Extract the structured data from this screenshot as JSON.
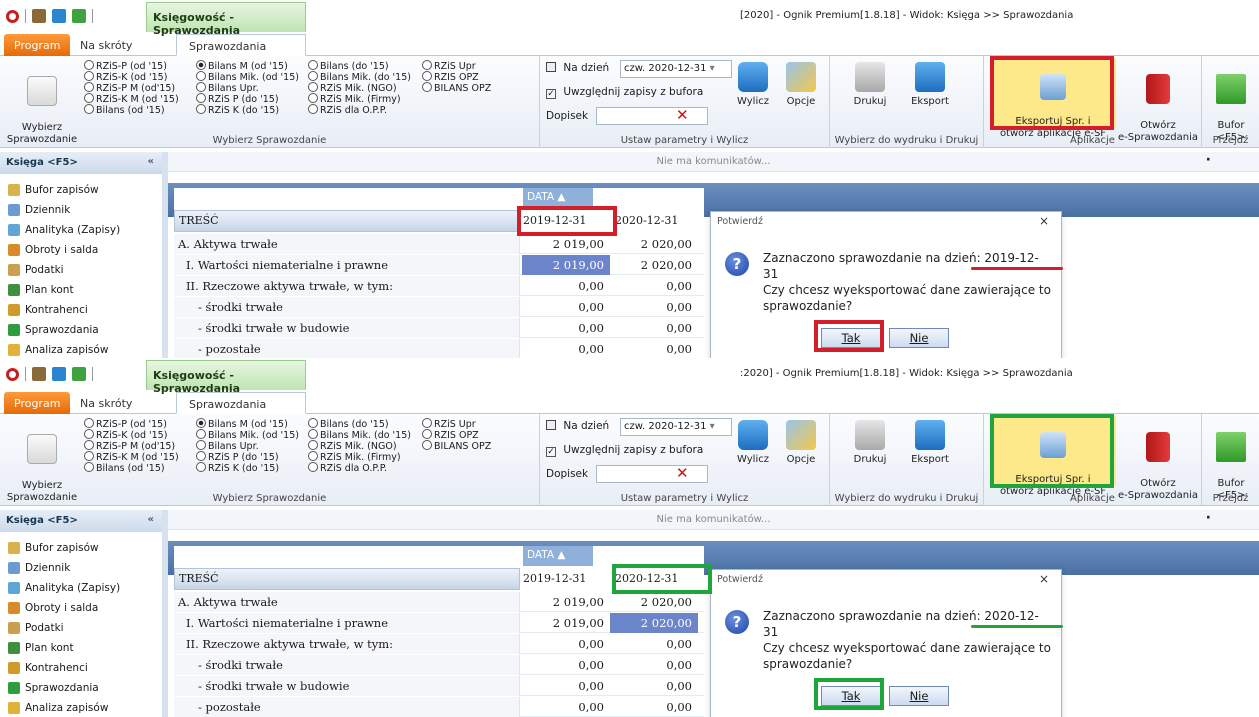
{
  "accent": {
    "red": "#d31f2a",
    "green": "#1ea53c",
    "orange": "#ea7a12"
  },
  "panels": [
    {
      "qat_icons": [
        "app-orb-icon",
        "calendar-icon",
        "document-blue-icon",
        "document-green-icon"
      ],
      "context_tab": "Księgowość - Sprawozdania",
      "window_title": "[2020] - Ognik Premium[1.8.18] - Widok: Księga >> Sprawozdania",
      "tabs": {
        "program": "Program",
        "shortcuts": "Na skróty",
        "reports": "Sprawozdania"
      },
      "ribbon": {
        "choose_report": {
          "label": "Wybierz\nSprawozdanie",
          "group": "Wybierz Sprawozdanie"
        },
        "radios_col1": [
          "RZiS-P (od '15)",
          "RZiS-K (od '15)",
          "RZiS-P M (od'15)",
          "RZiS-K M (od '15)",
          "Bilans (od '15)"
        ],
        "radios_col2": [
          "Bilans M (od '15)",
          "Bilans Mik. (od '15)",
          "Bilans Upr.",
          "RZiS P (do '15)",
          "RZiS K (do '15)"
        ],
        "radios_col3": [
          "Bilans (do '15)",
          "Bilans Mik. (do '15)",
          "RZiS Mik. (NGO)",
          "RZiS Mik. (Firmy)",
          "RZiS dla O.P.P."
        ],
        "radios_col4": [
          "RZiS Upr",
          "RZIS OPZ",
          "BILANS OPZ"
        ],
        "selected_radio": "Bilans M (od '15)",
        "params": {
          "date_label": "Na dzień",
          "date_value": "czw. 2020-12-31",
          "buffer_label": "Uwzględnij zapisy z bufora",
          "note_label": "Dopisek",
          "group": "Ustaw parametry i Wylicz"
        },
        "calc": "Wylicz",
        "options": "Opcje",
        "print": "Drukuj",
        "export": "Eksport",
        "print_group": "Wybierz do wydruku i Drukuj",
        "export_esf": "Eksportuj Spr. i\notwórz aplikację e-SF",
        "open_esf": "Otwórz\ne-Sprawozdania",
        "app_group": "Aplikacje",
        "buffer": "Bufor\n<F5>",
        "goto_group": "Przejdź"
      },
      "sidebar": {
        "title": "Księga <F5>",
        "items": [
          "Bufor zapisów",
          "Dziennik",
          "Analityka (Zapisy)",
          "Obroty i salda",
          "Podatki",
          "Plan kont",
          "Kontrahenci",
          "Sprawozdania",
          "Analiza zapisów"
        ]
      },
      "message": "Nie ma komunikatów...",
      "grid": {
        "group_header": "DATA ▲",
        "col_header": "TREŚĆ",
        "date_cols": [
          "2019-12-31",
          "2020-12-31"
        ],
        "rows": [
          {
            "label": "A. Aktywa trwałe",
            "v1": "2 019,00",
            "v2": "2 020,00"
          },
          {
            "label": "I. Wartości niematerialne i prawne",
            "v1": "2 019,00",
            "v2": "2 020,00"
          },
          {
            "label": "II. Rzeczowe aktywa trwałe, w tym:",
            "v1": "0,00",
            "v2": "0,00"
          },
          {
            "label": "- środki trwałe",
            "v1": "0,00",
            "v2": "0,00"
          },
          {
            "label": "- środki trwałe w budowie",
            "v1": "0,00",
            "v2": "0,00"
          },
          {
            "label": "- pozostałe",
            "v1": "0,00",
            "v2": "0,00"
          }
        ],
        "selected_col": 0
      },
      "dialog": {
        "title": "Potwierdź",
        "close": "×",
        "question_icon": "?",
        "line1": "Zaznaczono sprawozdanie na dzień: 2019-12-31",
        "line2": "Czy chcesz wyeksportować dane zawierające to sprawozdanie?",
        "yes": "Tak",
        "no": "Nie"
      },
      "highlight_color": "#d31f2a"
    },
    {
      "qat_icons": [
        "app-orb-icon",
        "calendar-icon",
        "document-blue-icon",
        "document-green-icon"
      ],
      "context_tab": "Księgowość - Sprawozdania",
      "window_title": ":2020] - Ognik Premium[1.8.18] - Widok: Księga >> Sprawozdania",
      "tabs": {
        "program": "Program",
        "shortcuts": "Na skróty",
        "reports": "Sprawozdania"
      },
      "ribbon": {
        "choose_report": {
          "label": "Wybierz\nSprawozdanie",
          "group": "Wybierz Sprawozdanie"
        },
        "radios_col1": [
          "RZiS-P (od '15)",
          "RZiS-K (od '15)",
          "RZiS-P M (od'15)",
          "RZiS-K M (od '15)",
          "Bilans (od '15)"
        ],
        "radios_col2": [
          "Bilans M (od '15)",
          "Bilans Mik. (od '15)",
          "Bilans Upr.",
          "RZiS P (do '15)",
          "RZiS K (do '15)"
        ],
        "radios_col3": [
          "Bilans (do '15)",
          "Bilans Mik. (do '15)",
          "RZiS Mik. (NGO)",
          "RZiS Mik. (Firmy)",
          "RZiS dla O.P.P."
        ],
        "radios_col4": [
          "RZiS Upr",
          "RZIS OPZ",
          "BILANS OPZ"
        ],
        "selected_radio": "Bilans M (od '15)",
        "params": {
          "date_label": "Na dzień",
          "date_value": "czw. 2020-12-31",
          "buffer_label": "Uwzględnij zapisy z bufora",
          "note_label": "Dopisek",
          "group": "Ustaw parametry i Wylicz"
        },
        "calc": "Wylicz",
        "options": "Opcje",
        "print": "Drukuj",
        "export": "Eksport",
        "print_group": "Wybierz do wydruku i Drukuj",
        "export_esf": "Eksportuj Spr. i\notwórz aplikację e-SF",
        "open_esf": "Otwórz\ne-Sprawozdania",
        "app_group": "Aplikacje",
        "buffer": "Bufor\n<F5>",
        "goto_group": "Przejdź"
      },
      "sidebar": {
        "title": "Księga <F5>",
        "items": [
          "Bufor zapisów",
          "Dziennik",
          "Analityka (Zapisy)",
          "Obroty i salda",
          "Podatki",
          "Plan kont",
          "Kontrahenci",
          "Sprawozdania",
          "Analiza zapisów"
        ]
      },
      "message": "Nie ma komunikatów...",
      "grid": {
        "group_header": "DATA ▲",
        "col_header": "TREŚĆ",
        "date_cols": [
          "2019-12-31",
          "2020-12-31"
        ],
        "rows": [
          {
            "label": "A. Aktywa trwałe",
            "v1": "2 019,00",
            "v2": "2 020,00"
          },
          {
            "label": "I. Wartości niematerialne i prawne",
            "v1": "2 019,00",
            "v2": "2 020,00"
          },
          {
            "label": "II. Rzeczowe aktywa trwałe, w tym:",
            "v1": "0,00",
            "v2": "0,00"
          },
          {
            "label": "- środki trwałe",
            "v1": "0,00",
            "v2": "0,00"
          },
          {
            "label": "- środki trwałe w budowie",
            "v1": "0,00",
            "v2": "0,00"
          },
          {
            "label": "- pozostałe",
            "v1": "0,00",
            "v2": "0,00"
          }
        ],
        "selected_col": 1
      },
      "dialog": {
        "title": "Potwierdź",
        "close": "×",
        "question_icon": "?",
        "line1": "Zaznaczono sprawozdanie na dzień: 2020-12-31",
        "line2": "Czy chcesz wyeksportować dane zawierające to sprawozdanie?",
        "yes": "Tak",
        "no": "Nie"
      },
      "highlight_color": "#1ea53c"
    }
  ]
}
